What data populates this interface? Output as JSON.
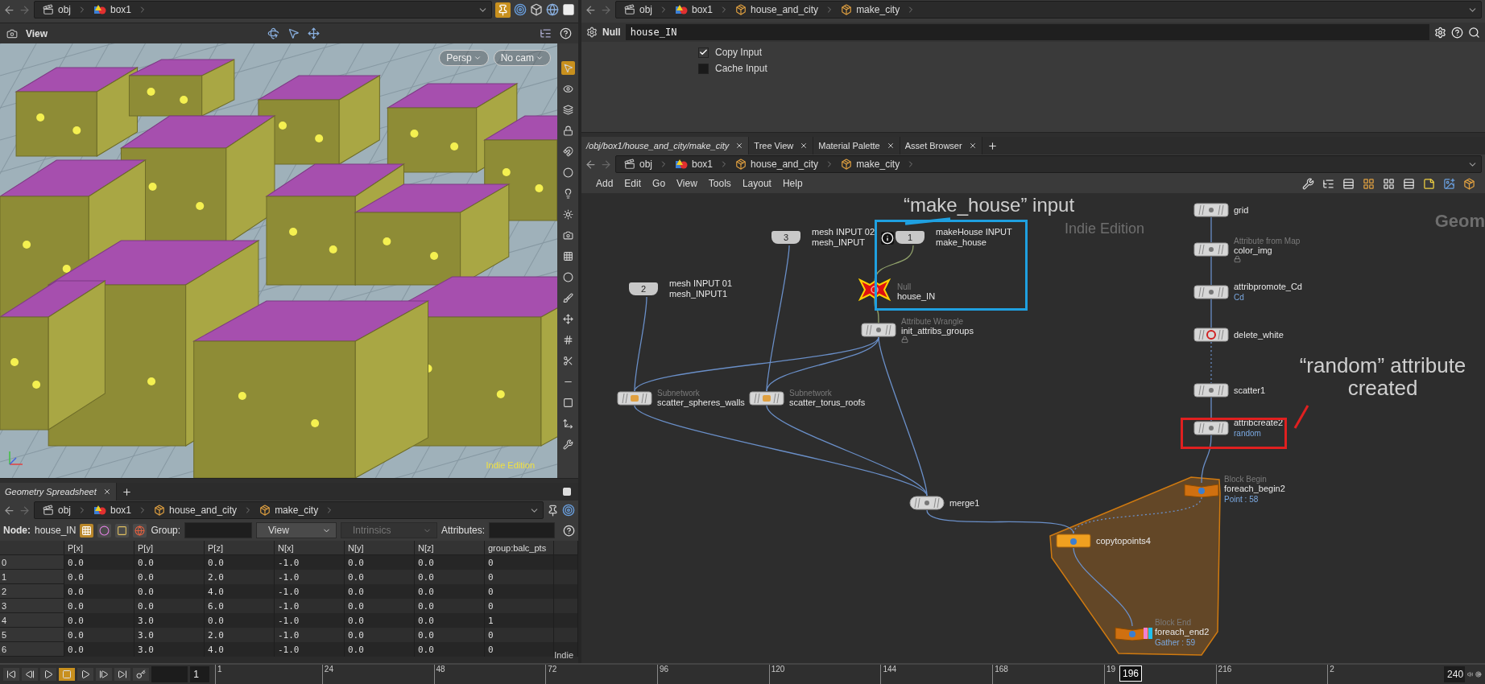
{
  "viewer": {
    "path": [
      {
        "label": "obj",
        "kind": "obj"
      },
      {
        "label": "box1",
        "kind": "geo"
      }
    ],
    "title": "View",
    "camera_buttons": [
      "Persp",
      "No cam"
    ],
    "watermark": "Indie Edition"
  },
  "spreadsheet": {
    "tab": "Geometry Spreadsheet",
    "path": [
      {
        "label": "obj",
        "kind": "obj"
      },
      {
        "label": "box1",
        "kind": "geo"
      },
      {
        "label": "house_and_city",
        "kind": "subnet"
      },
      {
        "label": "make_city",
        "kind": "subnet"
      }
    ],
    "node_label": "Node:",
    "node": "house_IN",
    "group_label": "Group:",
    "view": "View",
    "intrinsics": "Intrinsics",
    "attributes_label": "Attributes:",
    "columns": [
      "P[x]",
      "P[y]",
      "P[z]",
      "N[x]",
      "N[y]",
      "N[z]",
      "group:balc_pts"
    ],
    "rows": [
      {
        "index": "0",
        "cells": [
          "0.0",
          "0.0",
          "0.0",
          "-1.0",
          "0.0",
          "0.0",
          "0"
        ]
      },
      {
        "index": "1",
        "cells": [
          "0.0",
          "0.0",
          "2.0",
          "-1.0",
          "0.0",
          "0.0",
          "0"
        ]
      },
      {
        "index": "2",
        "cells": [
          "0.0",
          "0.0",
          "4.0",
          "-1.0",
          "0.0",
          "0.0",
          "0"
        ]
      },
      {
        "index": "3",
        "cells": [
          "0.0",
          "0.0",
          "6.0",
          "-1.0",
          "0.0",
          "0.0",
          "0"
        ]
      },
      {
        "index": "4",
        "cells": [
          "0.0",
          "3.0",
          "0.0",
          "-1.0",
          "0.0",
          "0.0",
          "1"
        ]
      },
      {
        "index": "5",
        "cells": [
          "0.0",
          "3.0",
          "2.0",
          "-1.0",
          "0.0",
          "0.0",
          "0"
        ]
      },
      {
        "index": "6",
        "cells": [
          "0.0",
          "3.0",
          "4.0",
          "-1.0",
          "0.0",
          "0.0",
          "0"
        ]
      }
    ],
    "watermark": "Indie"
  },
  "parameters": {
    "path": [
      {
        "label": "obj",
        "kind": "obj"
      },
      {
        "label": "box1",
        "kind": "geo"
      },
      {
        "label": "house_and_city",
        "kind": "subnet"
      },
      {
        "label": "make_city",
        "kind": "subnet"
      }
    ],
    "type": "Null",
    "name": "house_IN",
    "toggles": [
      {
        "label": "Copy Input",
        "checked": true
      },
      {
        "label": "Cache Input",
        "checked": false
      }
    ]
  },
  "network": {
    "tabs": [
      {
        "label": "/obj/box1/house_and_city/make_city",
        "selected": true
      },
      {
        "label": "Tree View",
        "selected": false
      },
      {
        "label": "Material Palette",
        "selected": false
      },
      {
        "label": "Asset Browser",
        "selected": false
      }
    ],
    "path": [
      {
        "label": "obj",
        "kind": "obj"
      },
      {
        "label": "box1",
        "kind": "geo"
      },
      {
        "label": "house_and_city",
        "kind": "subnet"
      },
      {
        "label": "make_city",
        "kind": "subnet"
      }
    ],
    "menu": [
      "Add",
      "Edit",
      "Go",
      "View",
      "Tools",
      "Layout",
      "Help"
    ],
    "watermark": "Indie Edition",
    "context": "Geom",
    "nodes": [
      {
        "kind": "input",
        "number": "2",
        "comment": "mesh INPUT 01",
        "name": "mesh_INPUT1",
        "selected": false
      },
      {
        "kind": "input",
        "number": "3",
        "comment": "mesh INPUT 02",
        "name": "mesh_INPUT",
        "selected": false
      },
      {
        "kind": "input",
        "number": "1",
        "comment": "makeHouse INPUT",
        "name": "make_house",
        "selected": false
      },
      {
        "kind": "null",
        "type_label": "Null",
        "name": "house_IN",
        "selected": true
      },
      {
        "kind": "sop",
        "type_label": "Attribute Wrangle",
        "name": "init_attribs_groups",
        "locked": true,
        "selected": false
      },
      {
        "kind": "subnet",
        "type_label": "Subnetwork",
        "name": "scatter_spheres_walls",
        "selected": false
      },
      {
        "kind": "subnet",
        "type_label": "Subnetwork",
        "name": "scatter_torus_roofs",
        "selected": false
      },
      {
        "kind": "merge",
        "name": "merge1",
        "selected": false
      },
      {
        "kind": "sop",
        "name": "grid",
        "selected": false
      },
      {
        "kind": "sop",
        "type_label": "Attribute from Map",
        "name": "color_img",
        "locked": true,
        "selected": false
      },
      {
        "kind": "sop",
        "name": "attribpromote_Cd",
        "info": "Cd",
        "selected": false
      },
      {
        "kind": "delete",
        "name": "delete_white",
        "selected": false
      },
      {
        "kind": "sop",
        "name": "scatter1",
        "selected": false
      },
      {
        "kind": "sop",
        "name": "attribcreate2",
        "info": "random",
        "selected": false
      },
      {
        "kind": "block",
        "type_label": "Block Begin",
        "name": "foreach_begin2",
        "info": "Point : 58",
        "selected": false
      },
      {
        "kind": "copy",
        "name": "copytopoints4",
        "selected": false
      },
      {
        "kind": "block",
        "type_label": "Block End",
        "name": "foreach_end2",
        "info": "Gather : 59",
        "display": true,
        "selected": false
      }
    ],
    "annotations": [
      {
        "text": "“make_house” input",
        "color": "#1fa0e0"
      },
      {
        "text": "“random” attribute created",
        "color": "#e02020"
      }
    ]
  },
  "timeline": {
    "start": "1",
    "ticks": [
      "1",
      "24",
      "48",
      "72",
      "96",
      "120",
      "144",
      "168",
      "19",
      "216",
      "2"
    ],
    "current": "196",
    "end": "240"
  }
}
